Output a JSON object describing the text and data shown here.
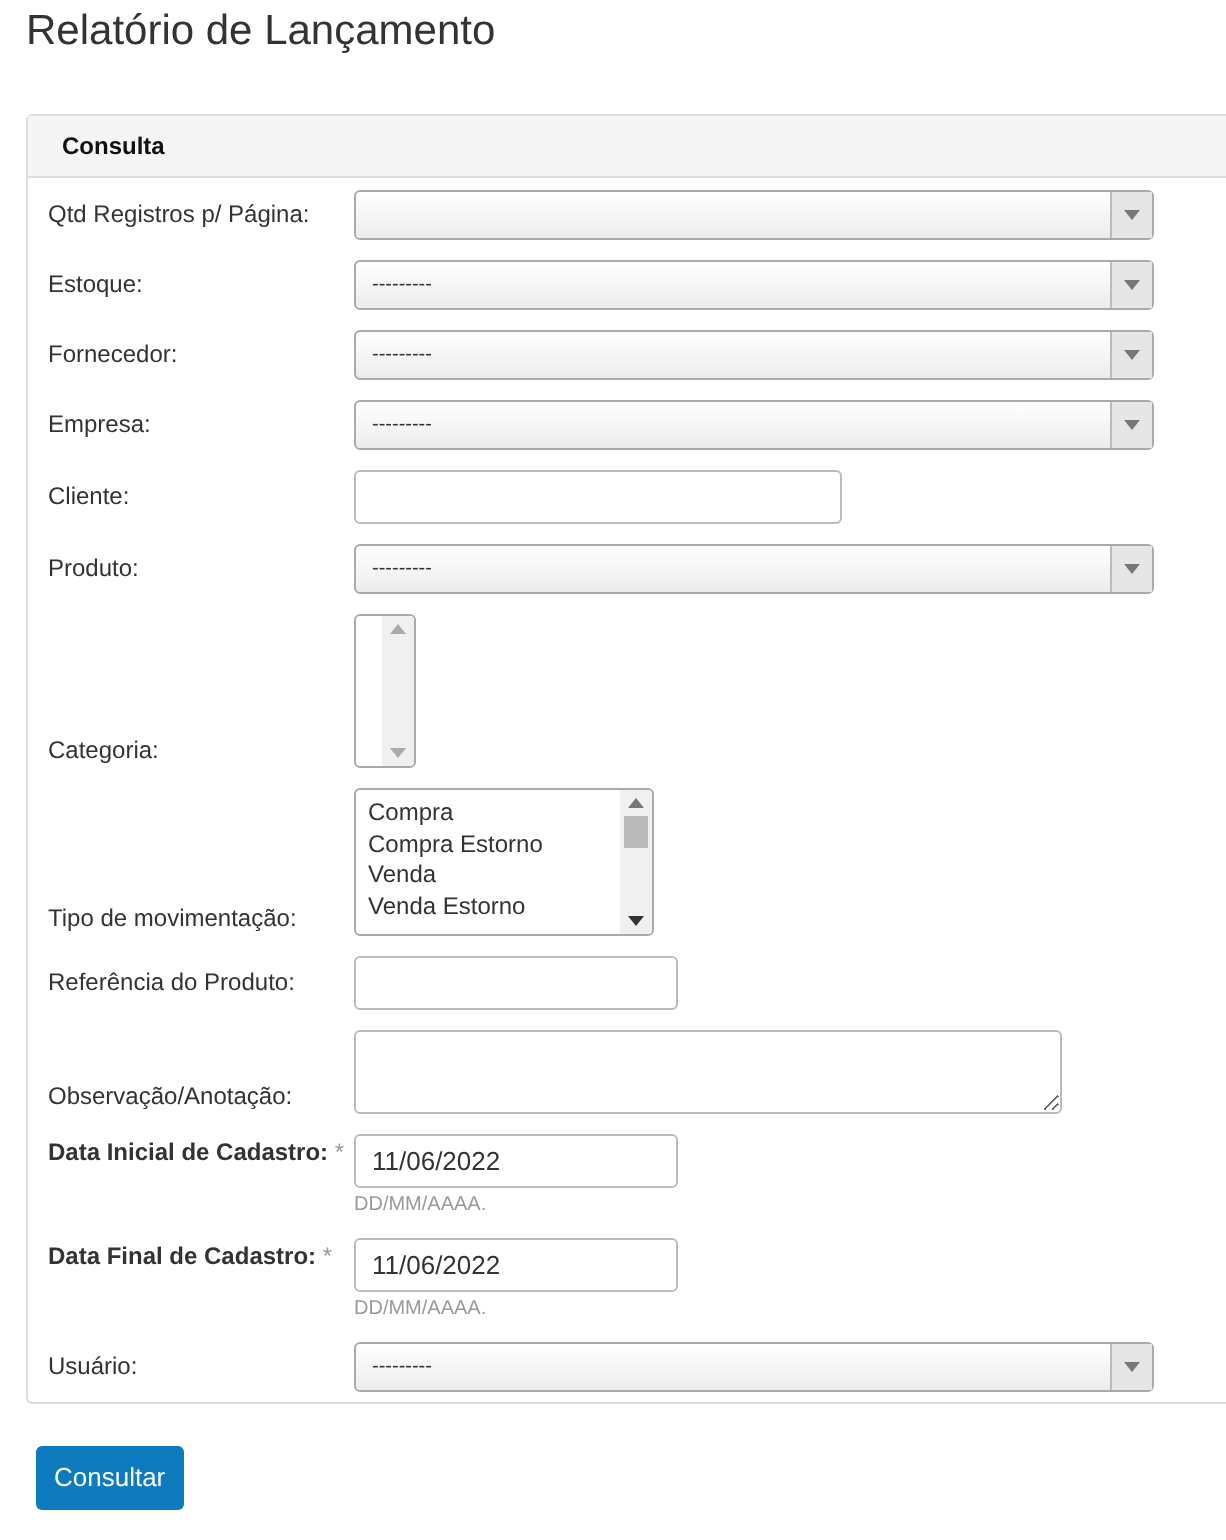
{
  "title": "Relatório de Lançamento",
  "panel": {
    "heading": "Consulta"
  },
  "fields": [
    {
      "kind": "select",
      "label": "Qtd Registros p/ Página:"
    },
    {
      "kind": "select",
      "label": "Estoque:",
      "value": "---------"
    },
    {
      "kind": "select",
      "label": "Fornecedor:",
      "value": "---------"
    },
    {
      "kind": "select",
      "label": "Empresa:",
      "value": "---------"
    },
    {
      "kind": "text",
      "label": "Cliente:"
    },
    {
      "kind": "select",
      "label": "Produto:",
      "value": "---------"
    },
    {
      "kind": "listbox",
      "label": "Categoria:"
    },
    {
      "kind": "listbox",
      "label": "Tipo de movimentação:",
      "options": [
        "Compra",
        "Compra Estorno",
        "Venda",
        "Venda Estorno"
      ]
    },
    {
      "kind": "text",
      "label": "Referência do Produto:"
    },
    {
      "kind": "textarea",
      "label": "Observação/Anotação:"
    },
    {
      "kind": "date",
      "label": "Data Inicial de Cadastro:",
      "required": true,
      "required_mark": "*",
      "value": "11/06/2022",
      "help": "DD/MM/AAAA."
    },
    {
      "kind": "date",
      "label": "Data Final de Cadastro:",
      "required": true,
      "required_mark": "*",
      "value": "11/06/2022",
      "help": "DD/MM/AAAA."
    },
    {
      "kind": "select",
      "label": "Usuário:",
      "value": "---------"
    }
  ],
  "submit": "Consultar"
}
